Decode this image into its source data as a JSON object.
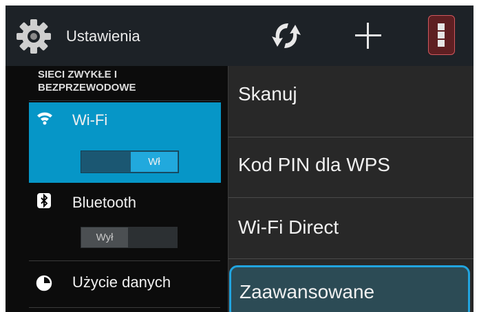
{
  "action_bar": {
    "title": "Ustawienia",
    "icons": [
      "gear-icon",
      "refresh-icon",
      "plus-icon",
      "overflow-menu-icon"
    ]
  },
  "settings": {
    "section_header_line1": "SIECI ZWYKŁE I",
    "section_header_line2": "BEZPRZEWODOWE",
    "items": [
      {
        "label": "Wi-Fi",
        "icon": "wifi-icon",
        "toggle": "Wł",
        "state": "on"
      },
      {
        "label": "Bluetooth",
        "icon": "bluetooth-icon",
        "toggle": "Wył",
        "state": "off"
      },
      {
        "label": "Użycie danych",
        "icon": "data-usage-icon"
      }
    ]
  },
  "overflow_menu": {
    "items": [
      {
        "label": "Skanuj"
      },
      {
        "label": "Kod PIN dla WPS"
      },
      {
        "label": "Wi-Fi Direct"
      },
      {
        "label": "Zaawansowane",
        "selected": true
      }
    ]
  },
  "colors": {
    "accent": "#0696c7",
    "toggle_on": "#21a9dd",
    "focus_ring": "#21a5e0",
    "overflow_highlight": "#5e1f22",
    "menu_background": "#282828"
  }
}
